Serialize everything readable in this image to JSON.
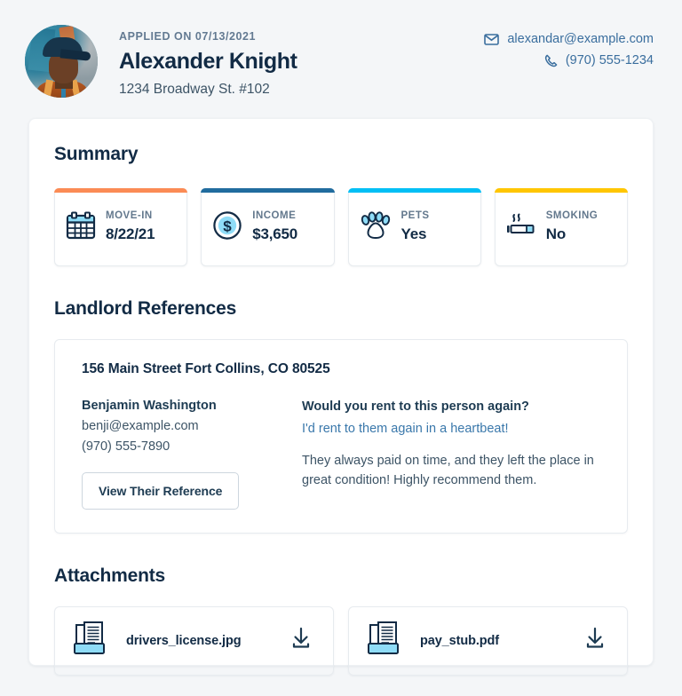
{
  "header": {
    "applied_on_label": "APPLIED ON 07/13/2021",
    "applicant_name": "Alexander Knight",
    "address": "1234 Broadway St. #102",
    "email": "alexandar@example.com",
    "phone": "(970) 555-1234",
    "email_icon": "envelope-icon",
    "phone_icon": "phone-icon",
    "avatar_icon": "applicant-photo"
  },
  "summary": {
    "title": "Summary",
    "stats": [
      {
        "label": "MOVE-IN",
        "value": "8/22/21",
        "icon": "calendar-icon",
        "accent": "#fb8b55"
      },
      {
        "label": "INCOME",
        "value": "$3,650",
        "icon": "dollar-circle-icon",
        "accent": "#216c9e"
      },
      {
        "label": "PETS",
        "value": "Yes",
        "icon": "paw-icon",
        "accent": "#00bff5"
      },
      {
        "label": "SMOKING",
        "value": "No",
        "icon": "cigarette-icon",
        "accent": "#ffc600"
      }
    ]
  },
  "references": {
    "title": "Landlord References",
    "items": [
      {
        "address": "156 Main Street Fort Collins, CO 80525",
        "name": "Benjamin Washington",
        "email": "benji@example.com",
        "phone": "(970) 555-7890",
        "button_label": "View Their Reference",
        "question": "Would you rent to this person again?",
        "answer": "I'd rent to them again in a heartbeat!",
        "note": "They always paid on time, and they left the place in great condition! Highly recommend them."
      }
    ]
  },
  "attachments": {
    "title": "Attachments",
    "items": [
      {
        "name": "drivers_license.jpg",
        "icon": "document-tray-icon",
        "action_icon": "download-icon"
      },
      {
        "name": "pay_stub.pdf",
        "icon": "document-tray-icon",
        "action_icon": "download-icon"
      }
    ]
  },
  "colors": {
    "navy": "#122b45",
    "link_blue": "#3a78ab",
    "light_blue": "#8fdcf7",
    "page_bg": "#f4f6f8"
  }
}
